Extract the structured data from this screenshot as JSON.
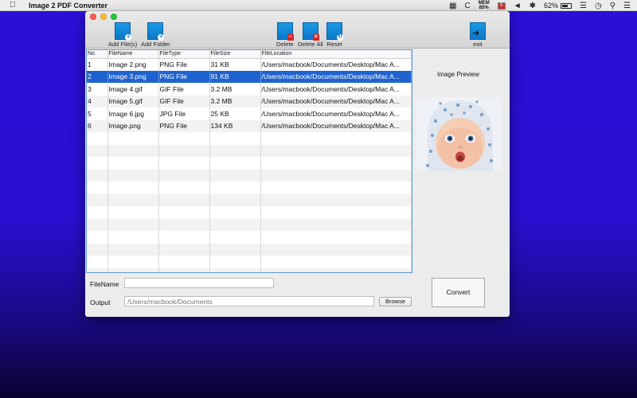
{
  "menubar": {
    "app_name": "Image 2 PDF Converter",
    "c_label": "C",
    "mem_top": "MEM",
    "mem_value": "85%",
    "flag_label": "5",
    "battery_text": "62%"
  },
  "toolbar": {
    "add_files": "Add File(s)",
    "add_folder": "Add Folder",
    "delete": "Delete",
    "delete_all": "Delete All",
    "reset": "Reset",
    "exit": "exit"
  },
  "table": {
    "columns": [
      "No",
      "FileName",
      "FileType",
      "FileSize",
      "FileLocation"
    ],
    "rows": [
      {
        "no": "1",
        "name": "Image 2.png",
        "type": "PNG File",
        "size": "31 KB",
        "location": "/Users/macbook/Documents/Desktop/Mac A..."
      },
      {
        "no": "2",
        "name": "Image 3.png",
        "type": "PNG File",
        "size": "91 KB",
        "location": "/Users/macbook/Documents/Desktop/Mac A..."
      },
      {
        "no": "3",
        "name": "Image 4.gif",
        "type": "GIF File",
        "size": "3.2 MB",
        "location": "/Users/macbook/Documents/Desktop/Mac A..."
      },
      {
        "no": "4",
        "name": "Image 5.gif",
        "type": "GIF File",
        "size": "3.2 MB",
        "location": "/Users/macbook/Documents/Desktop/Mac A..."
      },
      {
        "no": "5",
        "name": "Image 6.jpg",
        "type": "JPG File",
        "size": "25 KB",
        "location": "/Users/macbook/Documents/Desktop/Mac A..."
      },
      {
        "no": "6",
        "name": "Image.png",
        "type": "PNG File",
        "size": "134 KB",
        "location": "/Users/macbook/Documents/Desktop/Mac A..."
      }
    ],
    "selected_index": 1
  },
  "preview": {
    "title": "Image Preview"
  },
  "form": {
    "filename_label": "FileName",
    "filename_value": "",
    "output_label": "Output",
    "output_placeholder": "/Users/macbook/Documents",
    "browse_label": "Browse",
    "convert_label": "Convert"
  },
  "colors": {
    "selection": "#1e63d0",
    "accent_blue": "#0c76c7",
    "desktop": "#2a10d8"
  }
}
